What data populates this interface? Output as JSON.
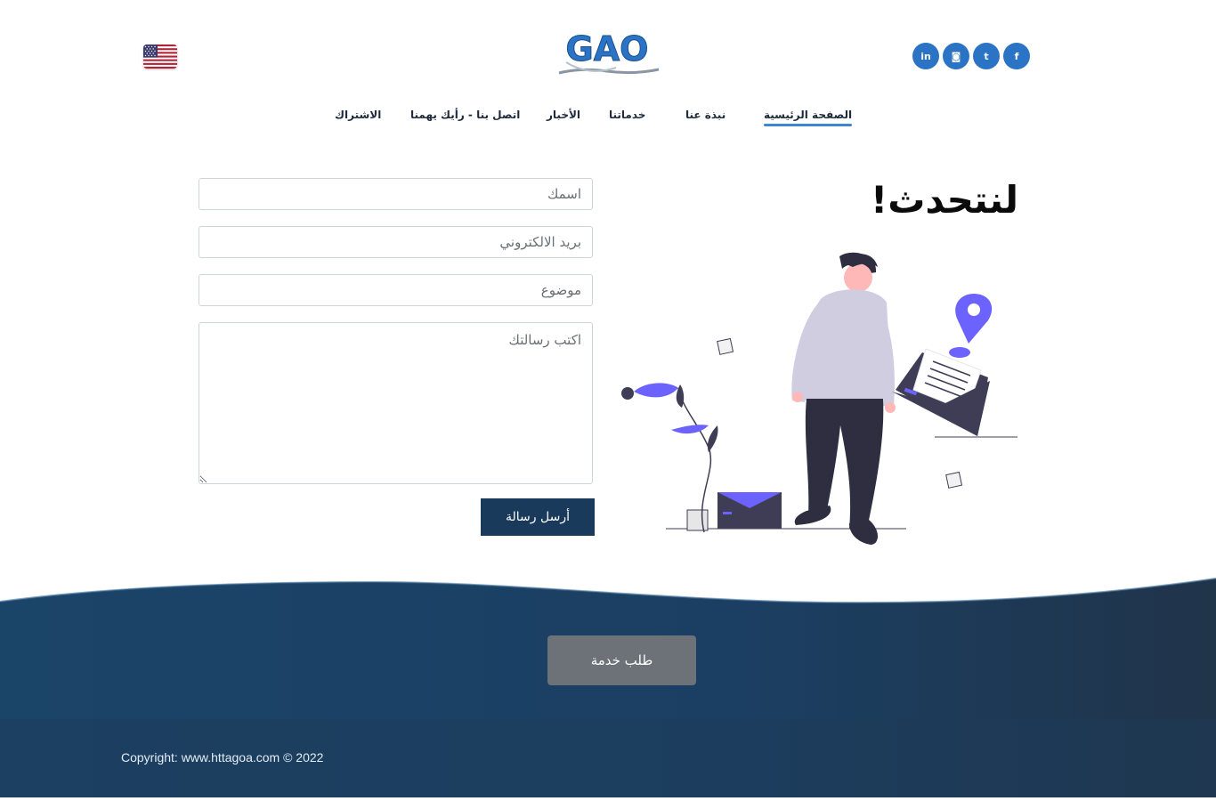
{
  "header": {
    "language_flag_icon": "us-flag-icon",
    "logo_text": "GAO",
    "social": [
      {
        "icon": "linkedin-icon",
        "glyph": "in"
      },
      {
        "icon": "instagram-icon",
        "glyph": "◙"
      },
      {
        "icon": "twitter-icon",
        "glyph": "t"
      },
      {
        "icon": "facebook-icon",
        "glyph": "f"
      }
    ]
  },
  "nav": {
    "home": "الصفحة الرئيسية",
    "about": "نبذة عنا",
    "services": "خدماتنا",
    "news": "الأخبار",
    "contact": "اتصل بنا - رأيك يهمنا",
    "subscribe": "الاشتراك"
  },
  "contact": {
    "title": "لنتحدث!",
    "name_placeholder": "اسمك",
    "email_placeholder": "بريد الالكتروني",
    "subject_placeholder": "موضوع",
    "message_placeholder": "اكتب رسالتك",
    "send_label": "أرسل رسالة"
  },
  "footer": {
    "request_service_label": "طلب خدمة",
    "copyright": "Copyright: www.httagoa.com © 2022"
  },
  "colors": {
    "accent": "#2a73c5",
    "navy": "#1a3a5c",
    "illustration_purple": "#6c63ff",
    "dark_figure": "#2f2e41"
  }
}
